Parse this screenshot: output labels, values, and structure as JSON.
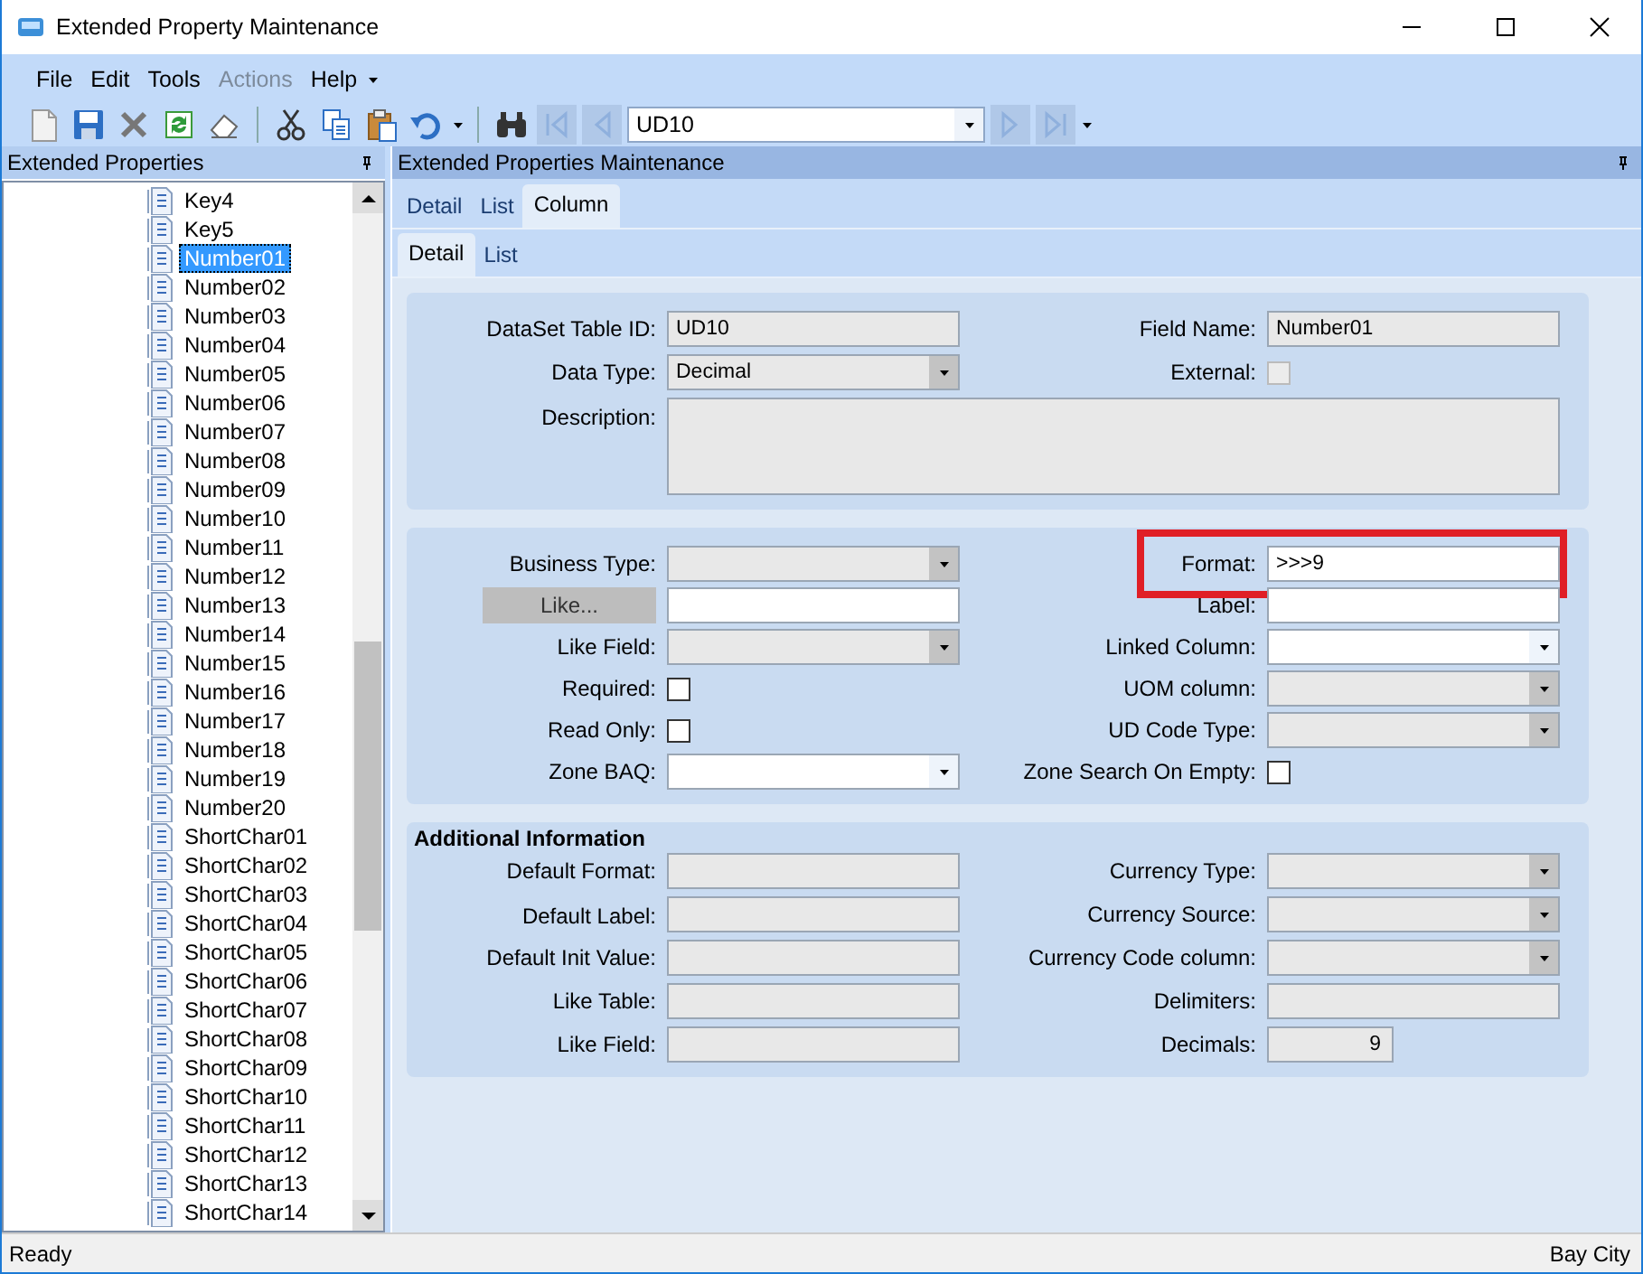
{
  "window": {
    "title": "Extended Property Maintenance"
  },
  "menu": [
    {
      "label": "File",
      "disabled": false
    },
    {
      "label": "Edit",
      "disabled": false
    },
    {
      "label": "Tools",
      "disabled": false
    },
    {
      "label": "Actions",
      "disabled": true
    },
    {
      "label": "Help",
      "disabled": false
    }
  ],
  "toolbar": {
    "record": "UD10"
  },
  "tree_panel": {
    "title": "Extended Properties",
    "items": [
      {
        "label": "Key4",
        "selected": false
      },
      {
        "label": "Key5",
        "selected": false
      },
      {
        "label": "Number01",
        "selected": true
      },
      {
        "label": "Number02",
        "selected": false
      },
      {
        "label": "Number03",
        "selected": false
      },
      {
        "label": "Number04",
        "selected": false
      },
      {
        "label": "Number05",
        "selected": false
      },
      {
        "label": "Number06",
        "selected": false
      },
      {
        "label": "Number07",
        "selected": false
      },
      {
        "label": "Number08",
        "selected": false
      },
      {
        "label": "Number09",
        "selected": false
      },
      {
        "label": "Number10",
        "selected": false
      },
      {
        "label": "Number11",
        "selected": false
      },
      {
        "label": "Number12",
        "selected": false
      },
      {
        "label": "Number13",
        "selected": false
      },
      {
        "label": "Number14",
        "selected": false
      },
      {
        "label": "Number15",
        "selected": false
      },
      {
        "label": "Number16",
        "selected": false
      },
      {
        "label": "Number17",
        "selected": false
      },
      {
        "label": "Number18",
        "selected": false
      },
      {
        "label": "Number19",
        "selected": false
      },
      {
        "label": "Number20",
        "selected": false
      },
      {
        "label": "ShortChar01",
        "selected": false
      },
      {
        "label": "ShortChar02",
        "selected": false
      },
      {
        "label": "ShortChar03",
        "selected": false
      },
      {
        "label": "ShortChar04",
        "selected": false
      },
      {
        "label": "ShortChar05",
        "selected": false
      },
      {
        "label": "ShortChar06",
        "selected": false
      },
      {
        "label": "ShortChar07",
        "selected": false
      },
      {
        "label": "ShortChar08",
        "selected": false
      },
      {
        "label": "ShortChar09",
        "selected": false
      },
      {
        "label": "ShortChar10",
        "selected": false
      },
      {
        "label": "ShortChar11",
        "selected": false
      },
      {
        "label": "ShortChar12",
        "selected": false
      },
      {
        "label": "ShortChar13",
        "selected": false
      },
      {
        "label": "ShortChar14",
        "selected": false
      }
    ]
  },
  "main_panel": {
    "title": "Extended Properties Maintenance",
    "tabs": [
      {
        "label": "Detail",
        "selected": false
      },
      {
        "label": "List",
        "selected": false
      },
      {
        "label": "Column",
        "selected": true
      }
    ],
    "subtabs": [
      {
        "label": "Detail",
        "selected": true
      },
      {
        "label": "List",
        "selected": false
      }
    ]
  },
  "sections": [
    {
      "rows": [
        [
          {
            "label": "DataSet Table ID:",
            "kind": "text",
            "value": "UD10",
            "readonly": true,
            "highlighted": false
          },
          {
            "label": "Field Name:",
            "kind": "text",
            "value": "Number01",
            "readonly": true,
            "highlighted": false
          }
        ],
        [
          {
            "label": "Data Type:",
            "kind": "combo",
            "value": "Decimal",
            "readonly": true,
            "highlighted": false
          },
          {
            "label": "External:",
            "kind": "checkbox",
            "checked": false,
            "readonly": true,
            "highlighted": false
          }
        ],
        [
          {
            "label": "Description:",
            "kind": "textarea",
            "readonly": true,
            "highlighted": false
          }
        ]
      ]
    },
    {
      "rows": [
        [
          {
            "label": "Business Type:",
            "kind": "combo",
            "readonly": true,
            "highlighted": false
          },
          {
            "label": "Format:",
            "kind": "text",
            "value": ">>>9",
            "readonly": false,
            "highlighted": true
          }
        ],
        [
          {
            "label": "Like...",
            "kind": "button-text",
            "readonly": false,
            "highlighted": false
          },
          {
            "label": "Label:",
            "kind": "text",
            "readonly": false,
            "highlighted": false
          }
        ],
        [
          {
            "label": "Like Field:",
            "kind": "combo",
            "readonly": true,
            "highlighted": false
          },
          {
            "label": "Linked Column:",
            "kind": "combo",
            "readonly": false,
            "highlighted": false
          }
        ],
        [
          {
            "label": "Required:",
            "kind": "checkbox",
            "checked": false,
            "readonly": false,
            "highlighted": false
          },
          {
            "label": "UOM column:",
            "kind": "combo",
            "readonly": true,
            "highlighted": false
          }
        ],
        [
          {
            "label": "Read Only:",
            "kind": "checkbox",
            "checked": false,
            "readonly": false,
            "highlighted": false
          },
          {
            "label": "UD Code Type:",
            "kind": "combo",
            "readonly": true,
            "highlighted": false
          }
        ],
        [
          {
            "label": "Zone BAQ:",
            "kind": "combo",
            "readonly": false,
            "highlighted": false
          },
          {
            "label": "Zone Search On Empty:",
            "kind": "checkbox",
            "checked": false,
            "readonly": false,
            "highlighted": false
          }
        ]
      ]
    },
    {
      "heading": "Additional Information",
      "rows": [
        [
          {
            "label": "Default Format:",
            "kind": "text",
            "readonly": true,
            "highlighted": false
          },
          {
            "label": "Currency Type:",
            "kind": "combo",
            "readonly": true,
            "highlighted": false
          }
        ],
        [
          {
            "label": "Default Label:",
            "kind": "text",
            "readonly": true,
            "highlighted": false
          },
          {
            "label": "Currency Source:",
            "kind": "combo",
            "readonly": true,
            "highlighted": false
          }
        ],
        [
          {
            "label": "Default Init Value:",
            "kind": "text",
            "readonly": true,
            "highlighted": false
          },
          {
            "label": "Currency Code column:",
            "kind": "combo",
            "readonly": true,
            "highlighted": false
          }
        ],
        [
          {
            "label": "Like Table:",
            "kind": "text",
            "readonly": true,
            "highlighted": false
          },
          {
            "label": "Delimiters:",
            "kind": "text",
            "readonly": true,
            "highlighted": false
          }
        ],
        [
          {
            "label": "Like Field:",
            "kind": "text",
            "readonly": true,
            "highlighted": false
          },
          {
            "label": "Decimals:",
            "kind": "number",
            "value": "9",
            "readonly": true,
            "highlighted": false
          }
        ]
      ]
    }
  ],
  "status_bar": {
    "left": "Ready",
    "right": "Bay City"
  }
}
